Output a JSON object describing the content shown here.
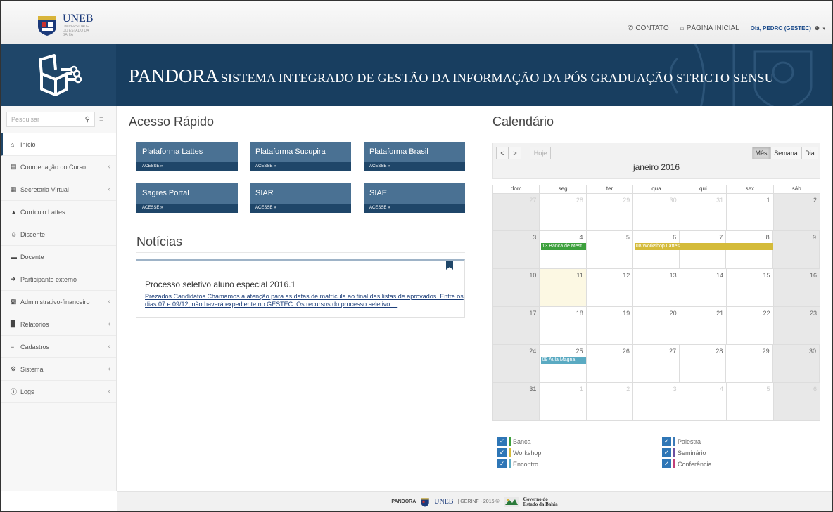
{
  "topbar": {
    "logo_text": "UNEB",
    "logo_sub": "UNIVERSIDADE DO ESTADO DA BAHIA",
    "contact": "CONTATO",
    "home": "PÁGINA INICIAL",
    "user": "Olá, PEDRO (GESTEC)"
  },
  "banner": {
    "title_big": "PANDORA",
    "title_small": "SISTEMA INTEGRADO DE GESTÃO DA INFORMAÇÃO DA PÓS GRADUAÇÃO STRICTO SENSU"
  },
  "sidebar": {
    "search_placeholder": "Pesquisar",
    "items": [
      {
        "label": "Início",
        "icon": "home-icon",
        "chevron": false
      },
      {
        "label": "Coordenação do Curso",
        "icon": "book-icon",
        "chevron": true
      },
      {
        "label": "Secretaria Virtual",
        "icon": "bank-icon",
        "chevron": true
      },
      {
        "label": "Currículo Lattes",
        "icon": "graduation-cap-icon",
        "chevron": false
      },
      {
        "label": "Discente",
        "icon": "users-icon",
        "chevron": false
      },
      {
        "label": "Docente",
        "icon": "teacher-icon",
        "chevron": false
      },
      {
        "label": "Participante externo",
        "icon": "sign-in-icon",
        "chevron": false
      },
      {
        "label": "Administrativo-financeiro",
        "icon": "money-icon",
        "chevron": true
      },
      {
        "label": "Relatórios",
        "icon": "bar-chart-icon",
        "chevron": true
      },
      {
        "label": "Cadastros",
        "icon": "list-icon",
        "chevron": true
      },
      {
        "label": "Sistema",
        "icon": "cogs-icon",
        "chevron": true
      },
      {
        "label": "Logs",
        "icon": "info-icon",
        "chevron": true
      }
    ]
  },
  "quick_access": {
    "title": "Acesso Rápido",
    "tiles": [
      {
        "label": "Plataforma Lattes",
        "action": "ACESSE »"
      },
      {
        "label": "Plataforma Sucupira",
        "action": "ACESSE »"
      },
      {
        "label": "Plataforma Brasil",
        "action": "ACESSE »"
      },
      {
        "label": "Sagres Portal",
        "action": "ACESSE »"
      },
      {
        "label": "SIAR",
        "action": "ACESSE »"
      },
      {
        "label": "SIAE",
        "action": "ACESSE »"
      }
    ]
  },
  "news": {
    "title": "Notícias",
    "item_title": "Processo seletivo aluno especial 2016.1",
    "item_body": "Prezados Candidatos Chamamos a atenção para as datas de matrícula ao final das listas de aprovados. Entre os dias 07 e 09/12, não haverá expediente no GESTEC. Os recursos do processo seletivo ..."
  },
  "calendar": {
    "title": "Calendário",
    "prev": "<",
    "next": ">",
    "today": "Hoje",
    "view_month": "Mês",
    "view_week": "Semana",
    "view_day": "Dia",
    "month_label": "janeiro 2016",
    "weekdays": [
      "dom",
      "seg",
      "ter",
      "qua",
      "qui",
      "sex",
      "sáb"
    ],
    "weeks": [
      [
        "27",
        "28",
        "29",
        "30",
        "31",
        "1",
        "2"
      ],
      [
        "3",
        "4",
        "5",
        "6",
        "7",
        "8",
        "9"
      ],
      [
        "10",
        "11",
        "12",
        "13",
        "14",
        "15",
        "16"
      ],
      [
        "17",
        "18",
        "19",
        "20",
        "21",
        "22",
        "23"
      ],
      [
        "24",
        "25",
        "26",
        "27",
        "28",
        "29",
        "30"
      ],
      [
        "31",
        "1",
        "2",
        "3",
        "4",
        "5",
        "6"
      ]
    ],
    "events": [
      {
        "label": "13 Banca de Mest",
        "color": "#3ca03c"
      },
      {
        "label": "08 Workshop Lattes",
        "color": "#d4bb3a"
      },
      {
        "label": "09 Aula Magna",
        "color": "#5aaac2"
      }
    ],
    "legend_left": [
      {
        "label": "Banca",
        "color": "#3ca03c"
      },
      {
        "label": "Workshop",
        "color": "#d4bb3a"
      },
      {
        "label": "Encontro",
        "color": "#5aaac2"
      }
    ],
    "legend_right": [
      {
        "label": "Palestra",
        "color": "#3a7ab8"
      },
      {
        "label": "Seminário",
        "color": "#6a4fa0"
      },
      {
        "label": "Conferência",
        "color": "#c0407a"
      }
    ]
  },
  "footer": {
    "brand": "PANDORA",
    "unb": "UNEB",
    "text": "| GERINF - 2015 ©",
    "gov1": "Governo do",
    "gov2": "Estado da Bahia"
  }
}
